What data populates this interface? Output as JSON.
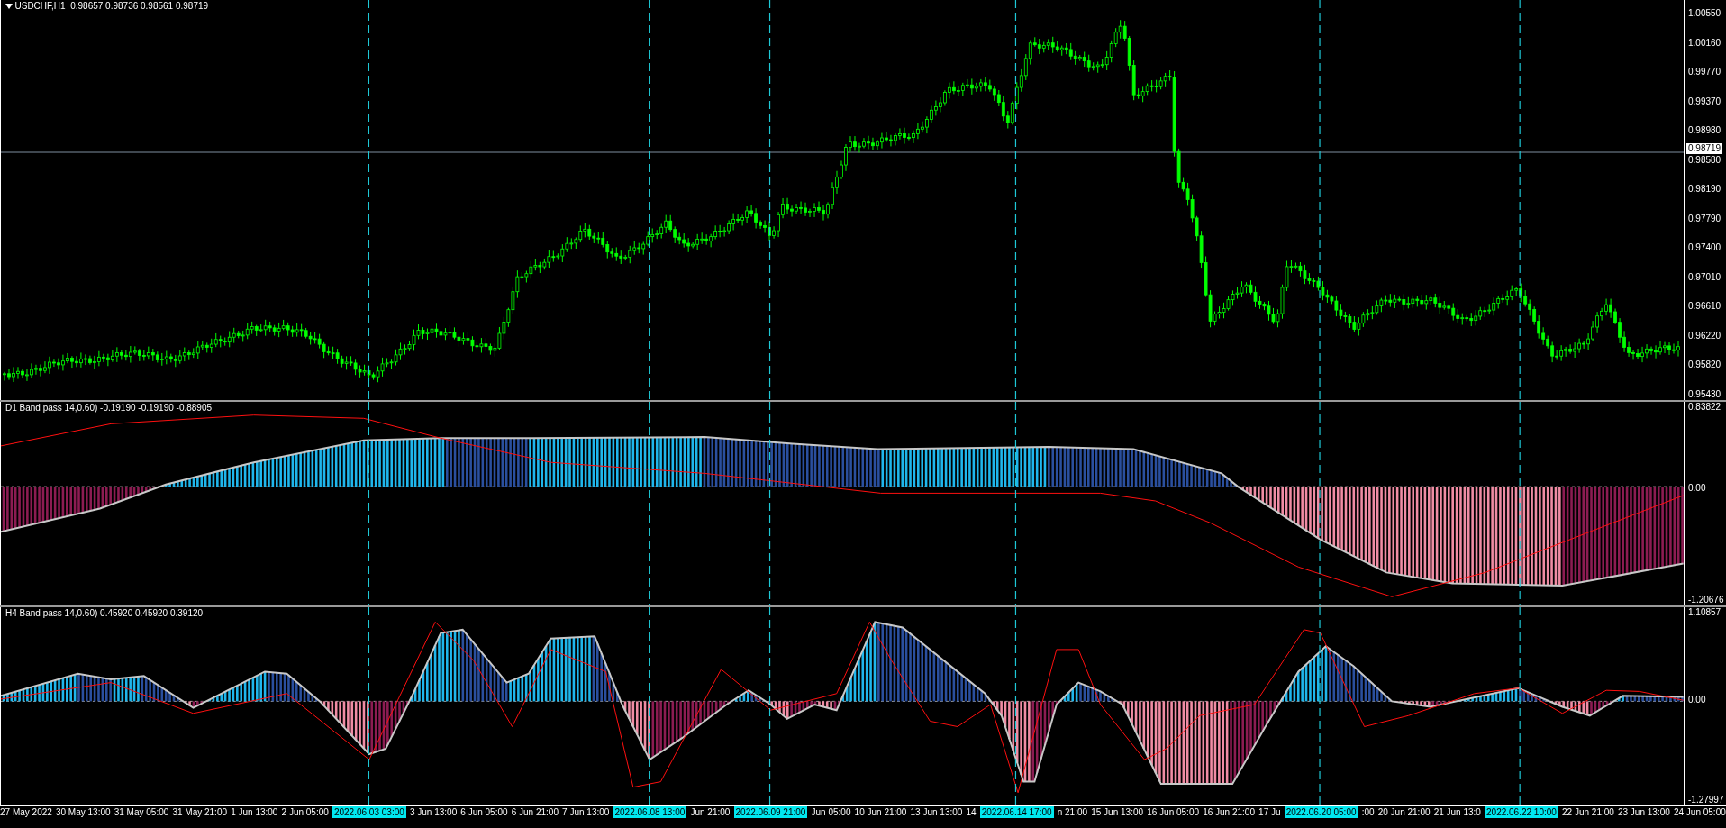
{
  "chart": {
    "header": "USDCHF,H1  0.98657 0.98736 0.98561 0.98719",
    "price_axis": [
      "1.00550",
      "1.00160",
      "0.99770",
      "0.99370",
      "0.98980",
      "0.98580",
      "0.98190",
      "0.97790",
      "0.97400",
      "0.97010",
      "0.96610",
      "0.96220",
      "0.95820",
      "0.95430"
    ],
    "current_price": "0.98719"
  },
  "indicators": [
    {
      "title": "D1 Band pass 14,0.60) -0.19190 -0.19190 -0.88905",
      "axis": [
        "0.83822",
        "0.00",
        "-1.20676"
      ]
    },
    {
      "title": "H4 Band pass 14,0.60) 0.45920 0.45920 0.39120",
      "axis": [
        "1.10857",
        "0.00",
        "-1.27997"
      ]
    }
  ],
  "time_axis": [
    {
      "text": "27 May 2022",
      "kind": "tick"
    },
    {
      "text": "30 May 13:00",
      "kind": "tick"
    },
    {
      "text": "31 May 05:00",
      "kind": "tick"
    },
    {
      "text": "31 May 21:00",
      "kind": "tick"
    },
    {
      "text": "1 Jun 13:00",
      "kind": "tick"
    },
    {
      "text": "2 Jun 05:00",
      "kind": "tick"
    },
    {
      "text": "2022.06.03 03:00",
      "kind": "marker"
    },
    {
      "text": "3 Jun 13:00",
      "kind": "tick"
    },
    {
      "text": "6 Jun 05:00",
      "kind": "tick"
    },
    {
      "text": "6 Jun 21:00",
      "kind": "tick"
    },
    {
      "text": "7 Jun 13:00",
      "kind": "tick"
    },
    {
      "text": "2022.06.08 13:00",
      "kind": "marker"
    },
    {
      "text": "Jun 21:00",
      "kind": "tick"
    },
    {
      "text": "2022.06.09 21:00",
      "kind": "marker"
    },
    {
      "text": "Jun 05:00",
      "kind": "tick"
    },
    {
      "text": "10 Jun 21:00",
      "kind": "tick"
    },
    {
      "text": "13 Jun 13:00",
      "kind": "tick"
    },
    {
      "text": "14",
      "kind": "tick"
    },
    {
      "text": "2022.06.14 17:00",
      "kind": "marker"
    },
    {
      "text": "n 21:00",
      "kind": "tick"
    },
    {
      "text": "15 Jun 13:00",
      "kind": "tick"
    },
    {
      "text": "16 Jun 05:00",
      "kind": "tick"
    },
    {
      "text": "16 Jun 21:00",
      "kind": "tick"
    },
    {
      "text": "17 Ju",
      "kind": "tick"
    },
    {
      "text": "2022.06.20 05:00",
      "kind": "marker"
    },
    {
      "text": ":00",
      "kind": "tick"
    },
    {
      "text": "20 Jun 21:00",
      "kind": "tick"
    },
    {
      "text": "21 Jun 13:0",
      "kind": "tick"
    },
    {
      "text": "2022.06.22 10:00",
      "kind": "marker"
    },
    {
      "text": "22 Jun 21:00",
      "kind": "tick"
    },
    {
      "text": "23 Jun 13:00",
      "kind": "tick"
    },
    {
      "text": "24 Jun 05:00",
      "kind": "tick"
    }
  ]
}
